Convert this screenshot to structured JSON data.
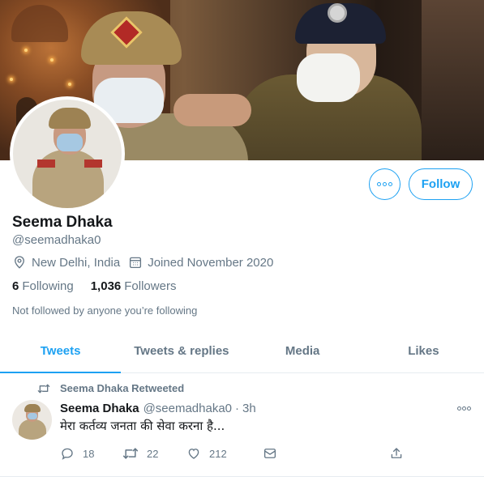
{
  "profile": {
    "name": "Seema Dhaka",
    "handle": "@seemadhaka0",
    "location": "New Delhi, India",
    "joined": "Joined November 2020",
    "following_count": "6",
    "following_label": "Following",
    "followers_count": "1,036",
    "followers_label": "Followers",
    "not_followed": "Not followed by anyone you’re following"
  },
  "buttons": {
    "follow": "Follow",
    "more_icon": "more-horizontal-icon"
  },
  "tabs": [
    {
      "label": "Tweets",
      "active": true
    },
    {
      "label": "Tweets & replies",
      "active": false
    },
    {
      "label": "Media",
      "active": false
    },
    {
      "label": "Likes",
      "active": false
    }
  ],
  "tweet": {
    "retweet_label": "Seema Dhaka Retweeted",
    "author_name": "Seema Dhaka",
    "author_handle": "@seemadhaka0",
    "separator": "·",
    "time": "3h",
    "text": "मेरा कर्तव्य जनता की सेवा करना है...",
    "replies": "18",
    "retweets": "22",
    "likes": "212"
  },
  "colors": {
    "accent": "#1da1f2",
    "text": "#14171a",
    "secondary": "#657786",
    "border": "#e6ecf0"
  }
}
